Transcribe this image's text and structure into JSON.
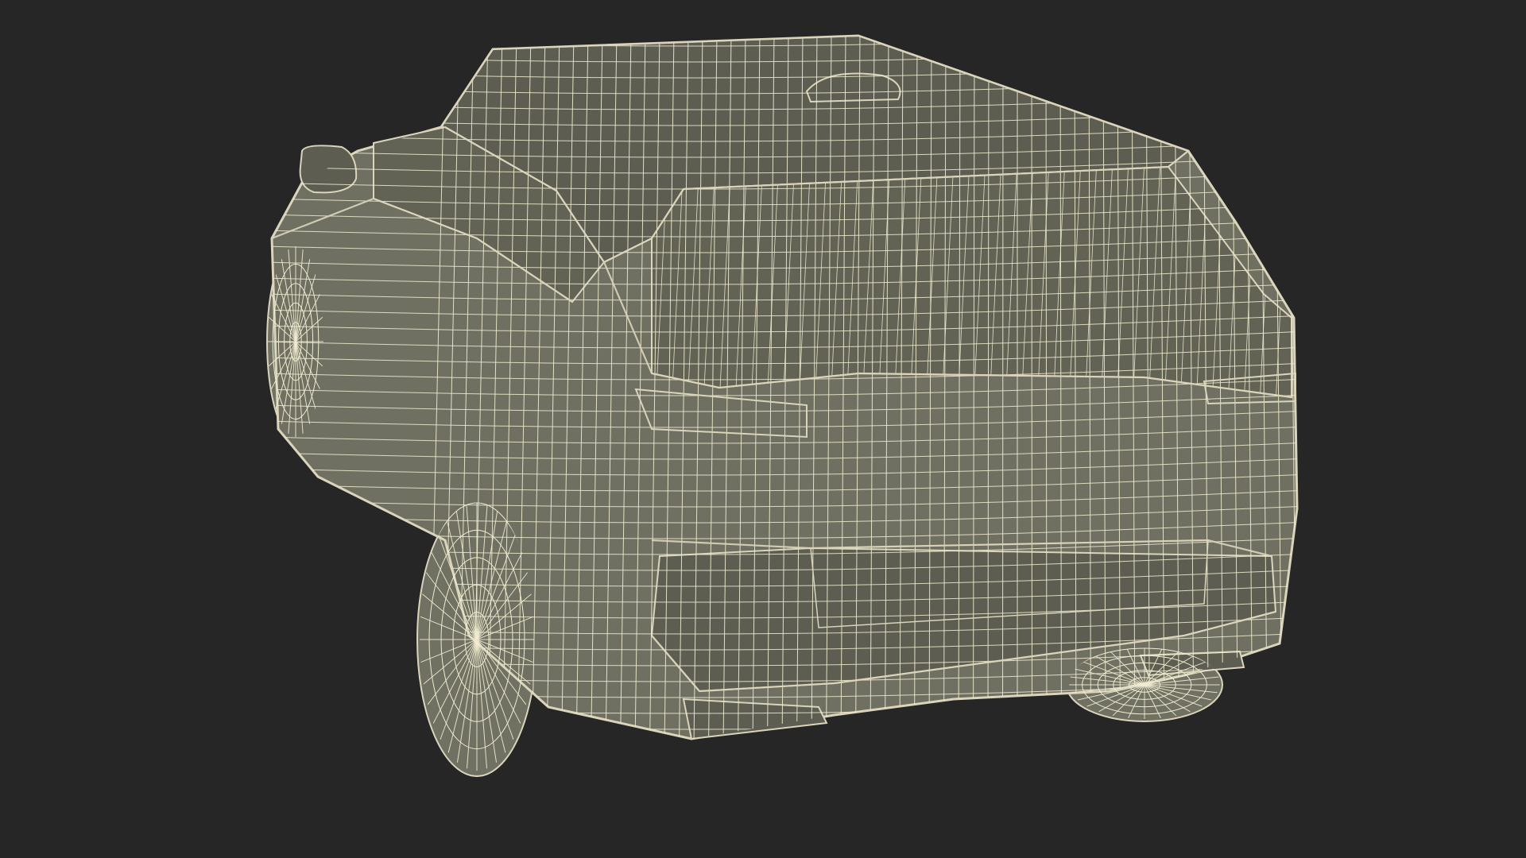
{
  "scene": {
    "subject": "suv-wireframe-rear-three-quarter",
    "colors": {
      "background": "#262626",
      "body_fill": "#6f7061",
      "body_shade": "#5d5e51",
      "glass_fill": "#626355",
      "tire_fill": "#707162",
      "wire": "#f1ecd2",
      "edge": "#d9d4bb"
    }
  }
}
